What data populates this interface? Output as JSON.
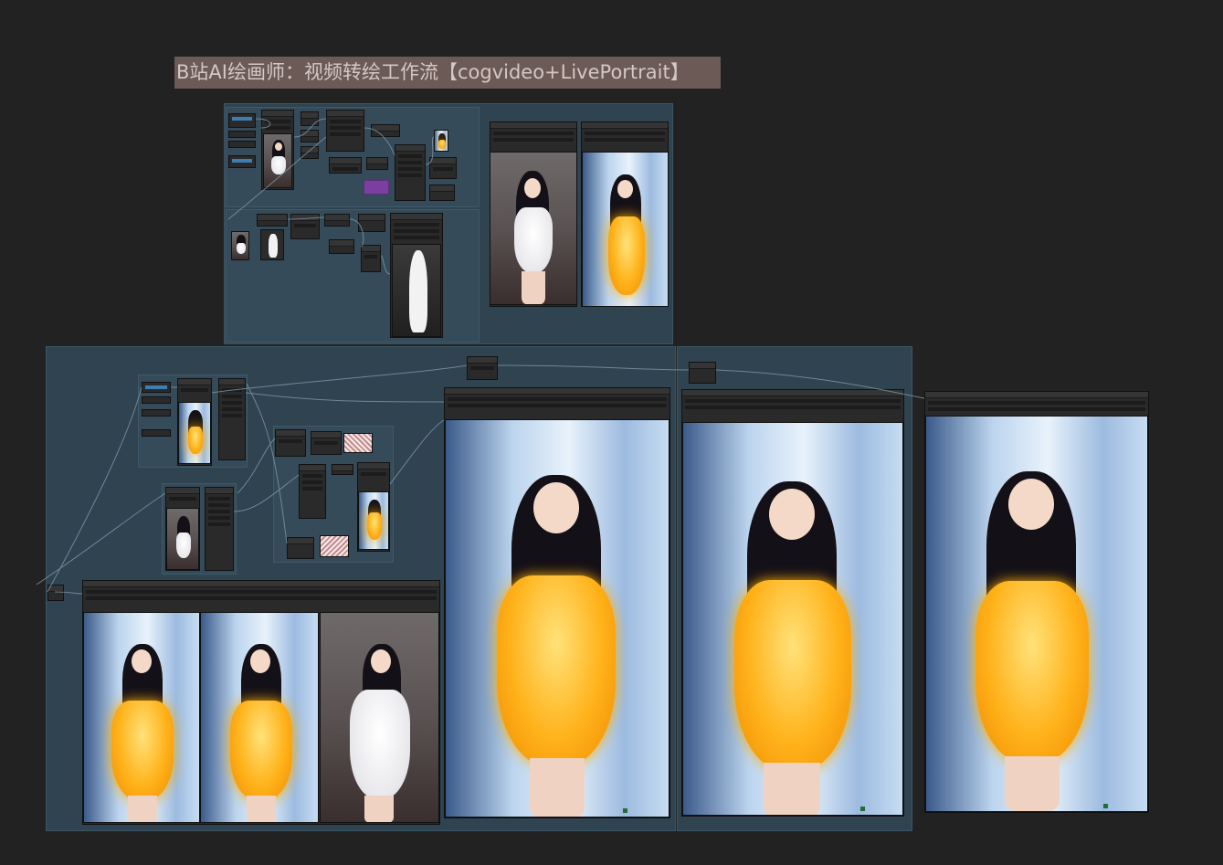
{
  "canvas": {
    "title_banner": "B站AI绘画师：视频转绘工作流【cogvideo+LivePortrait】"
  },
  "colors": {
    "background": "#222222",
    "group_fill": "#2f4350",
    "banner_fill": "#6b5a56",
    "accent_blue": "#3d7fb4",
    "purple_node": "#7a3fa0"
  },
  "icons": [
    "wire-link-icon"
  ]
}
